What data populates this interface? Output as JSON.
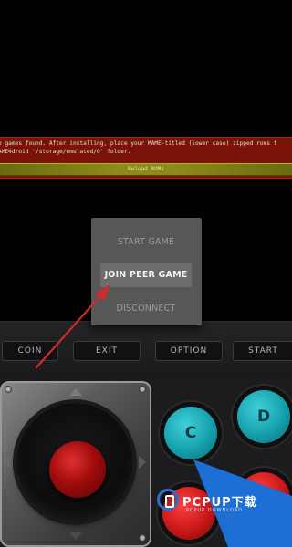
{
  "notification": {
    "line1": "o games found. After installing, place your MAME-titled (lower case) zipped roms t",
    "line2": "AME4droid '/storage/emulated/0' folder.",
    "reload_label": "Reload ROMs"
  },
  "controller": {
    "coin_label": "COIN",
    "exit_label": "EXIT",
    "option_label": "OPTION",
    "start_label": "START",
    "buttons": {
      "c": "C",
      "d": "D"
    }
  },
  "dialog": {
    "items": [
      {
        "label": "START GAME",
        "enabled": false
      },
      {
        "label": "JOIN PEER GAME",
        "enabled": true,
        "highlighted": true
      },
      {
        "label": "DISCONNECT",
        "enabled": false
      }
    ]
  },
  "watermark": {
    "brand": "PCPUP下载",
    "sub": "PCPUP DOWNLOAD"
  },
  "colors": {
    "background": "#000000",
    "banner": "#7a1408",
    "reload_bar": "#8c8a1a",
    "dialog": "#575757",
    "arrow": "#d12a2a",
    "button_cyan": "#15a0ac",
    "button_red": "#c81818",
    "watermark_blue": "#1d6fd6"
  }
}
